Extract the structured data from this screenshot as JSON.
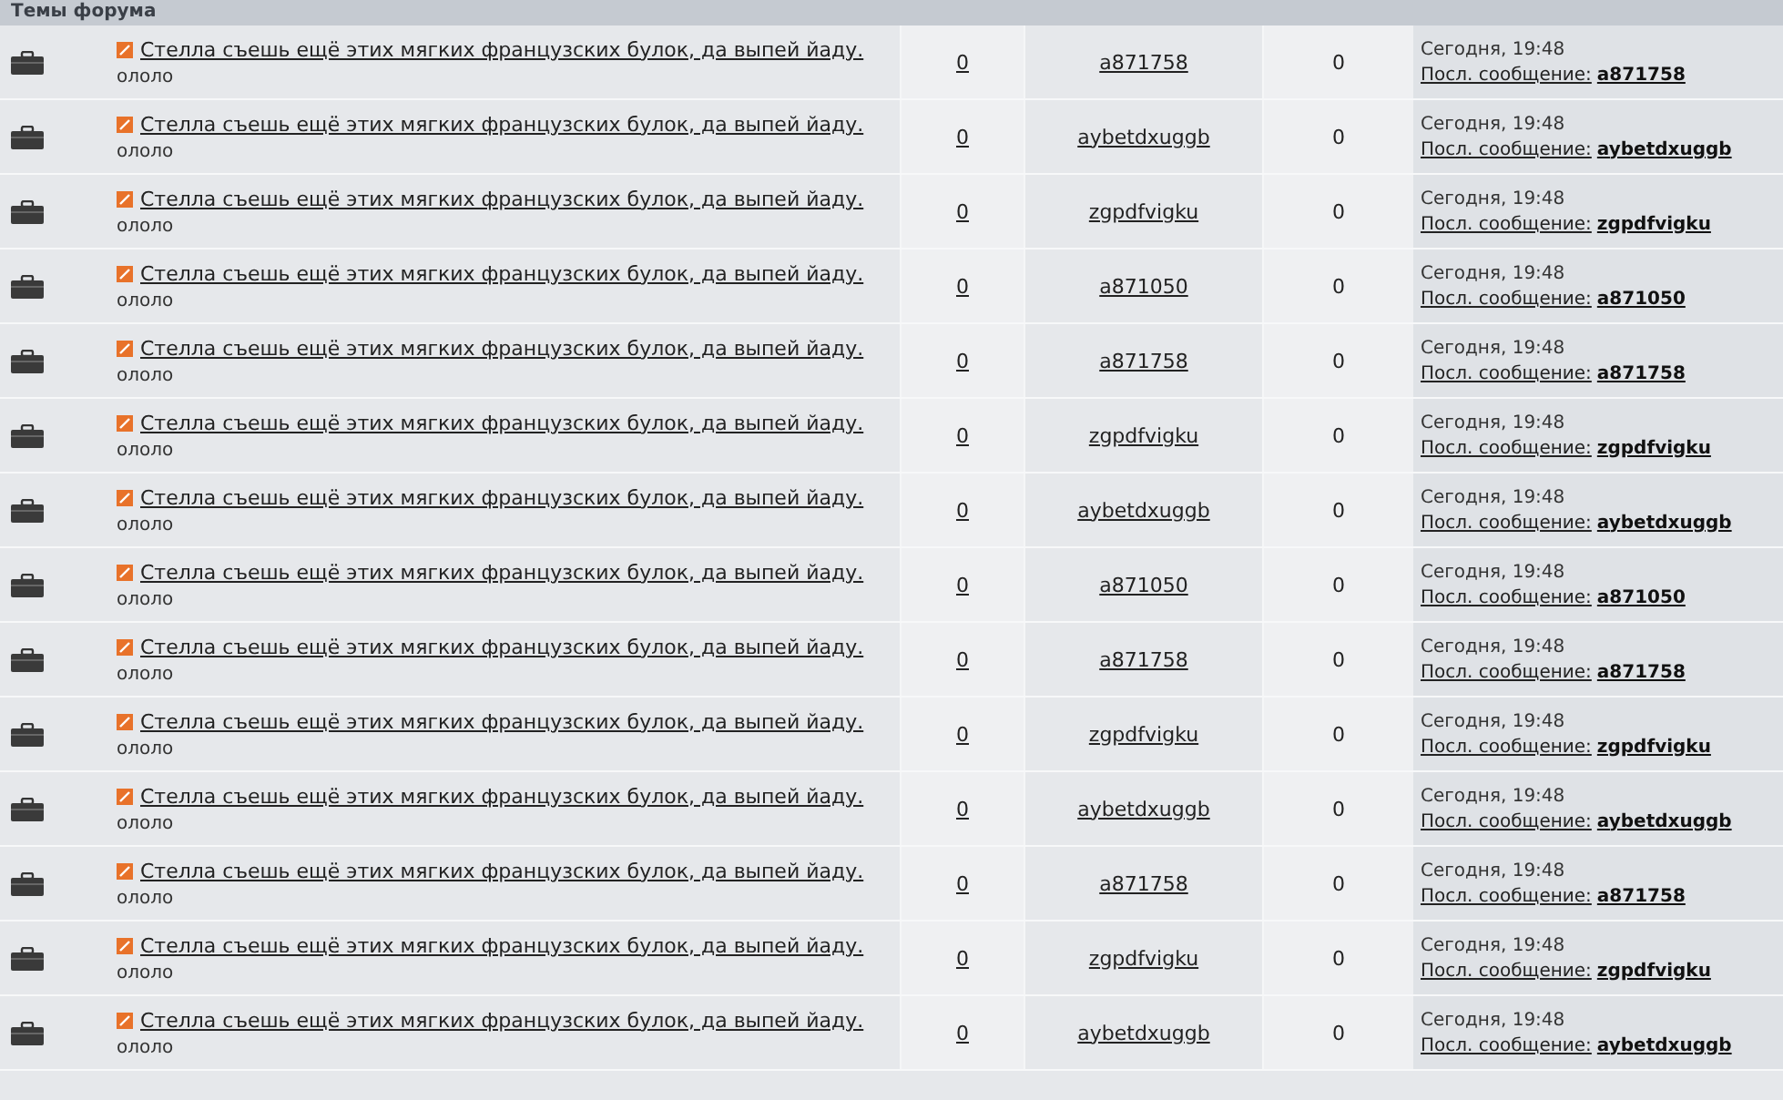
{
  "header": {
    "title": "Темы форума"
  },
  "topics": [
    {
      "title": "Стелла съешь ещё этих мягких французских булок, да выпей йаду.",
      "description": "ололо",
      "replies": "0",
      "author": "a871758",
      "views": "0",
      "time": "Сегодня, 19:48",
      "last_label": "Посл. сообщение:",
      "last_author": "a871758"
    },
    {
      "title": "Стелла съешь ещё этих мягких французских булок, да выпей йаду.",
      "description": "ололо",
      "replies": "0",
      "author": "aybetdxuggb",
      "views": "0",
      "time": "Сегодня, 19:48",
      "last_label": "Посл. сообщение:",
      "last_author": "aybetdxuggb"
    },
    {
      "title": "Стелла съешь ещё этих мягких французских булок, да выпей йаду.",
      "description": "ололо",
      "replies": "0",
      "author": "zgpdfvigku",
      "views": "0",
      "time": "Сегодня, 19:48",
      "last_label": "Посл. сообщение:",
      "last_author": "zgpdfvigku"
    },
    {
      "title": "Стелла съешь ещё этих мягких французских булок, да выпей йаду.",
      "description": "ололо",
      "replies": "0",
      "author": "a871050",
      "views": "0",
      "time": "Сегодня, 19:48",
      "last_label": "Посл. сообщение:",
      "last_author": "a871050"
    },
    {
      "title": "Стелла съешь ещё этих мягких французских булок, да выпей йаду.",
      "description": "ололо",
      "replies": "0",
      "author": "a871758",
      "views": "0",
      "time": "Сегодня, 19:48",
      "last_label": "Посл. сообщение:",
      "last_author": "a871758"
    },
    {
      "title": "Стелла съешь ещё этих мягких французских булок, да выпей йаду.",
      "description": "ололо",
      "replies": "0",
      "author": "zgpdfvigku",
      "views": "0",
      "time": "Сегодня, 19:48",
      "last_label": "Посл. сообщение:",
      "last_author": "zgpdfvigku"
    },
    {
      "title": "Стелла съешь ещё этих мягких французских булок, да выпей йаду.",
      "description": "ололо",
      "replies": "0",
      "author": "aybetdxuggb",
      "views": "0",
      "time": "Сегодня, 19:48",
      "last_label": "Посл. сообщение:",
      "last_author": "aybetdxuggb"
    },
    {
      "title": "Стелла съешь ещё этих мягких французских булок, да выпей йаду.",
      "description": "ололо",
      "replies": "0",
      "author": "a871050",
      "views": "0",
      "time": "Сегодня, 19:48",
      "last_label": "Посл. сообщение:",
      "last_author": "a871050"
    },
    {
      "title": "Стелла съешь ещё этих мягких французских булок, да выпей йаду.",
      "description": "ололо",
      "replies": "0",
      "author": "a871758",
      "views": "0",
      "time": "Сегодня, 19:48",
      "last_label": "Посл. сообщение:",
      "last_author": "a871758"
    },
    {
      "title": "Стелла съешь ещё этих мягких французских булок, да выпей йаду.",
      "description": "ололо",
      "replies": "0",
      "author": "zgpdfvigku",
      "views": "0",
      "time": "Сегодня, 19:48",
      "last_label": "Посл. сообщение:",
      "last_author": "zgpdfvigku"
    },
    {
      "title": "Стелла съешь ещё этих мягких французских булок, да выпей йаду.",
      "description": "ололо",
      "replies": "0",
      "author": "aybetdxuggb",
      "views": "0",
      "time": "Сегодня, 19:48",
      "last_label": "Посл. сообщение:",
      "last_author": "aybetdxuggb"
    },
    {
      "title": "Стелла съешь ещё этих мягких французских булок, да выпей йаду.",
      "description": "ололо",
      "replies": "0",
      "author": "a871758",
      "views": "0",
      "time": "Сегодня, 19:48",
      "last_label": "Посл. сообщение:",
      "last_author": "a871758"
    },
    {
      "title": "Стелла съешь ещё этих мягких французских булок, да выпей йаду.",
      "description": "ололо",
      "replies": "0",
      "author": "zgpdfvigku",
      "views": "0",
      "time": "Сегодня, 19:48",
      "last_label": "Посл. сообщение:",
      "last_author": "zgpdfvigku"
    },
    {
      "title": "Стелла съешь ещё этих мягких французских булок, да выпей йаду.",
      "description": "ололо",
      "replies": "0",
      "author": "aybetdxuggb",
      "views": "0",
      "time": "Сегодня, 19:48",
      "last_label": "Посл. сообщение:",
      "last_author": "aybetdxuggb"
    }
  ]
}
